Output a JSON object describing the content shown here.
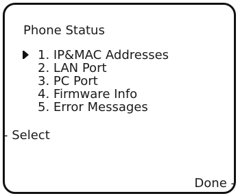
{
  "screen": {
    "title": "Phone Status",
    "menu": {
      "items": [
        {
          "label": "1. IP&MAC Addresses",
          "selected": true
        },
        {
          "label": "2. LAN Port",
          "selected": false
        },
        {
          "label": "3. PC Port",
          "selected": false
        },
        {
          "label": "4. Firmware Info",
          "selected": false
        },
        {
          "label": "5. Error Messages",
          "selected": false
        }
      ],
      "cursor_icon": "triangle-right-icon"
    },
    "softkeys": {
      "left_label": "- Select",
      "right_label": "Done -"
    }
  }
}
